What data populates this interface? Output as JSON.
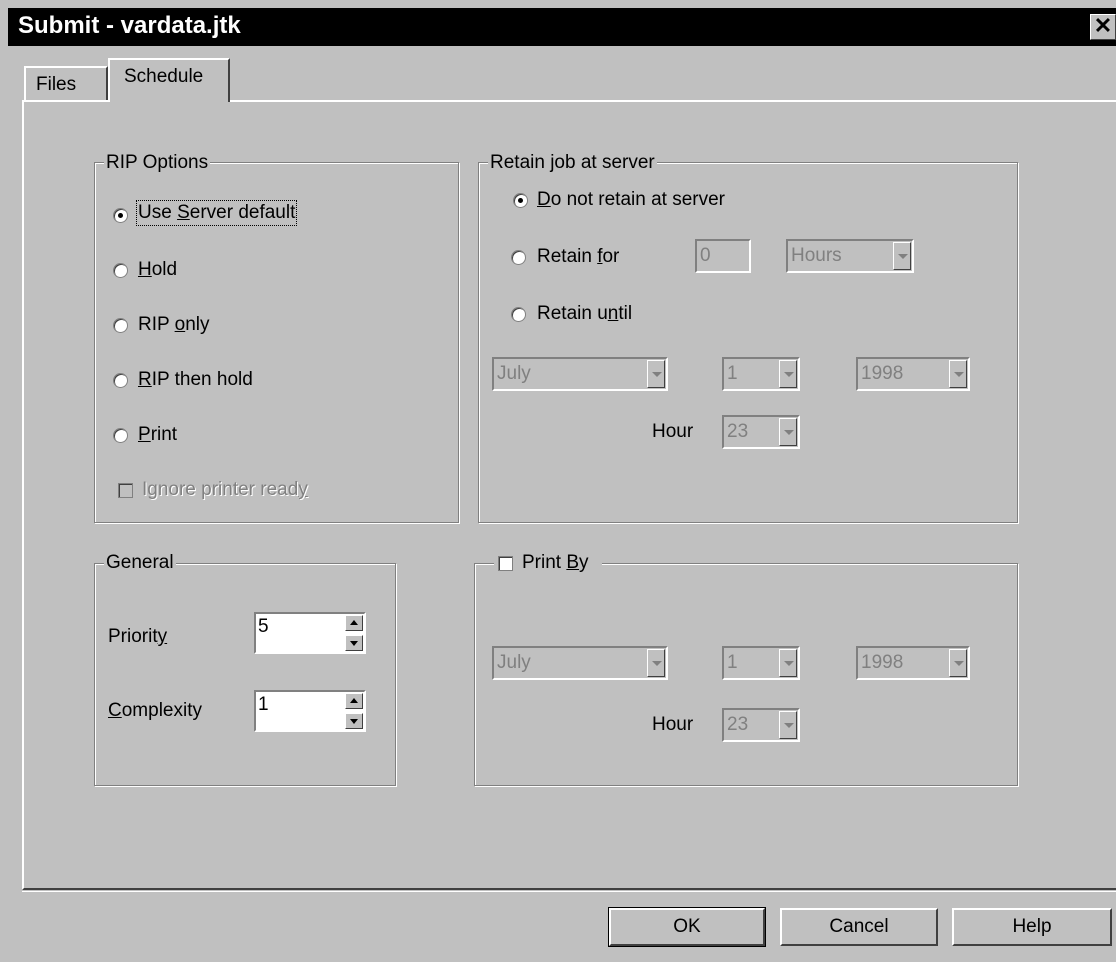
{
  "window": {
    "title": "Submit - vardata.jtk",
    "close_glyph": "✕"
  },
  "tabs": [
    {
      "label": "Files"
    },
    {
      "label": "Schedule"
    }
  ],
  "rip_options": {
    "legend": "RIP Options",
    "options": [
      {
        "label": "Use Server default",
        "selected": true
      },
      {
        "label": "Hold",
        "selected": false
      },
      {
        "label": "RIP only",
        "selected": false
      },
      {
        "label": "RIP then hold",
        "selected": false
      },
      {
        "label": "Print",
        "selected": false
      }
    ],
    "ignore_printer_ready": {
      "label": "Ignore printer ready",
      "checked": false,
      "enabled": false
    }
  },
  "retain": {
    "legend": "Retain job at server",
    "options": [
      {
        "label": "Do not retain at server",
        "selected": true
      },
      {
        "label": "Retain for",
        "selected": false
      },
      {
        "label": "Retain until",
        "selected": false
      }
    ],
    "retain_for_value": "0",
    "retain_for_unit": "Hours",
    "month": "July",
    "day": "1",
    "year": "1998",
    "hour_label": "Hour",
    "hour": "23"
  },
  "general": {
    "legend": "General",
    "priority_label": "Priority",
    "priority": "5",
    "complexity_label": "Complexity",
    "complexity": "1"
  },
  "print_by": {
    "label": "Print By",
    "checked": false,
    "month": "July",
    "day": "1",
    "year": "1998",
    "hour_label": "Hour",
    "hour": "23"
  },
  "buttons": {
    "ok": "OK",
    "cancel": "Cancel",
    "help": "Help"
  }
}
